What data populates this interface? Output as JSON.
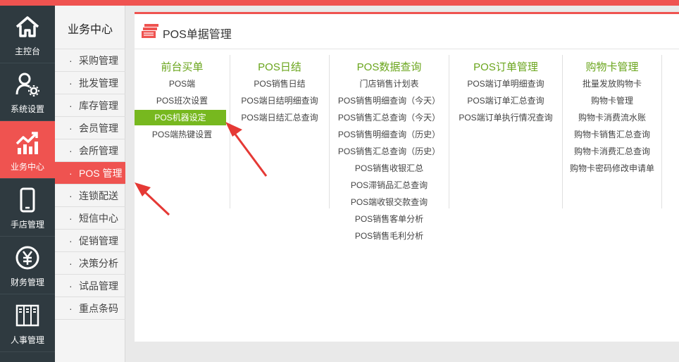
{
  "left_nav": [
    {
      "label": "主控台",
      "icon": "home-icon"
    },
    {
      "label": "系统设置",
      "icon": "user-gear-icon"
    },
    {
      "label": "业务中心",
      "icon": "chart-growth-icon",
      "active": true
    },
    {
      "label": "手店管理",
      "icon": "mobile-phone-icon"
    },
    {
      "label": "财务管理",
      "icon": "yen-coin-icon"
    },
    {
      "label": "人事管理",
      "icon": "cabinet-icon"
    }
  ],
  "submenu": {
    "title": "业务中心",
    "items": [
      {
        "label": "采购管理"
      },
      {
        "label": "批发管理"
      },
      {
        "label": "库存管理"
      },
      {
        "label": "会员管理"
      },
      {
        "label": "会所管理"
      },
      {
        "label": "POS 管理",
        "active": true
      },
      {
        "label": "连锁配送"
      },
      {
        "label": "短信中心"
      },
      {
        "label": "促销管理"
      },
      {
        "label": "决策分析"
      },
      {
        "label": "试品管理"
      },
      {
        "label": "重点条码"
      }
    ]
  },
  "panel": {
    "icon": "document-stack-icon",
    "title": "POS单据管理",
    "columns": [
      {
        "title": "前台买单",
        "links": [
          "POS端",
          "POS班次设置",
          "POS机器设定",
          "POS端热键设置"
        ],
        "active_index": 2
      },
      {
        "title": "POS日结",
        "links": [
          "POS销售日结",
          "POS端日结明细查询",
          "POS端日结汇总查询"
        ]
      },
      {
        "title": "POS数据查询",
        "links": [
          "门店销售计划表",
          "POS销售明细查询（今天）",
          "POS销售汇总查询（今天）",
          "POS销售明细查询（历史）",
          "POS销售汇总查询（历史）",
          "POS销售收银汇总",
          "POS滞销品汇总查询",
          "POS端收银交款查询",
          "POS销售客单分析",
          "POS销售毛利分析"
        ]
      },
      {
        "title": "POS订单管理",
        "links": [
          "POS端订单明细查询",
          "POS端订单汇总查询",
          "POS端订单执行情况查询"
        ]
      },
      {
        "title": "购物卡管理",
        "links": [
          "批量发放购物卡",
          "购物卡管理",
          "购物卡消费流水账",
          "购物卡销售汇总查询",
          "购物卡消费汇总查询",
          "购物卡密码修改申请单"
        ]
      }
    ]
  },
  "colors": {
    "accent_red": "#ef5350",
    "nav_bg": "#2f3a40",
    "green": "#6aa51c",
    "active_green": "#77b81f",
    "arrow_red": "#e53935"
  }
}
